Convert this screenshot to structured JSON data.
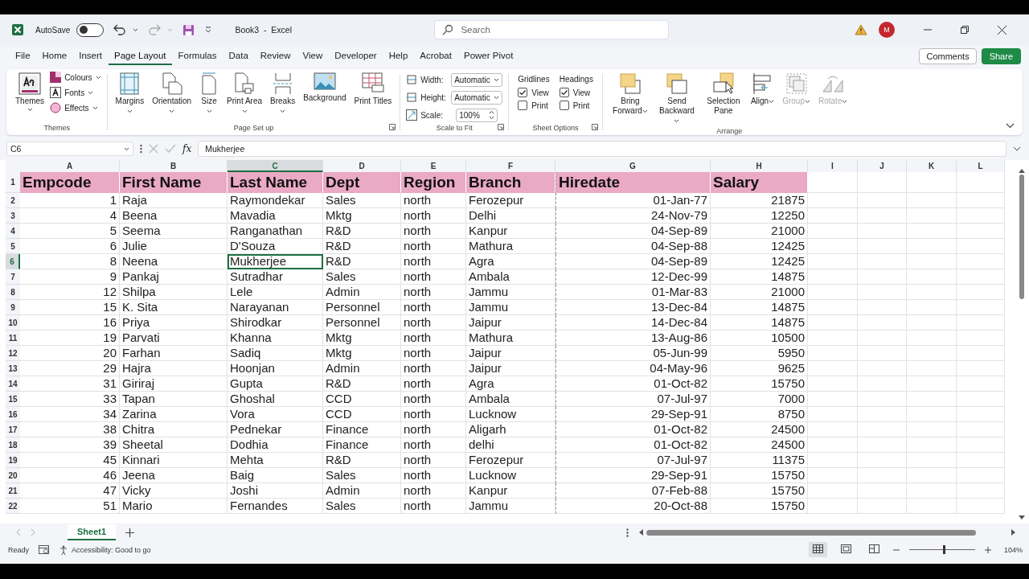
{
  "titlebar": {
    "autosave": {
      "label": "AutoSave",
      "on": false
    },
    "title": "Book3  -  Excel",
    "search": {
      "placeholder": "Search"
    },
    "avatar": "M"
  },
  "tabs": [
    {
      "label": "File",
      "selected": false
    },
    {
      "label": "Home",
      "selected": false
    },
    {
      "label": "Insert",
      "selected": false
    },
    {
      "label": "Page Layout",
      "selected": true
    },
    {
      "label": "Formulas",
      "selected": false
    },
    {
      "label": "Data",
      "selected": false
    },
    {
      "label": "Review",
      "selected": false
    },
    {
      "label": "View",
      "selected": false
    },
    {
      "label": "Developer",
      "selected": false
    },
    {
      "label": "Help",
      "selected": false
    },
    {
      "label": "Acrobat",
      "selected": false
    },
    {
      "label": "Power Pivot",
      "selected": false
    }
  ],
  "comments_button": "Comments",
  "share_button": "Share",
  "themes_group": {
    "label": "Themes",
    "button": "Themes",
    "items": [
      {
        "label": "Colours",
        "kind": "colours"
      },
      {
        "label": "Fonts",
        "kind": "fonts"
      },
      {
        "label": "Effects",
        "kind": "effects"
      }
    ]
  },
  "page_setup_group": {
    "label": "Page Set up",
    "buttons": [
      {
        "label": "Margins",
        "kind": "margins",
        "dropdown": true
      },
      {
        "label": "Orientation",
        "kind": "orientation",
        "dropdown": true
      },
      {
        "label": "Size",
        "kind": "size",
        "dropdown": true
      },
      {
        "label": "Print Area",
        "kind": "printarea",
        "dropdown": true
      },
      {
        "label": "Breaks",
        "kind": "breaks",
        "dropdown": true
      },
      {
        "label": "Background",
        "kind": "background",
        "dropdown": false
      },
      {
        "label": "Print Titles",
        "kind": "printtitles",
        "dropdown": false
      }
    ]
  },
  "scale_group": {
    "label": "Scale to Fit",
    "fields": [
      {
        "label": "Width:",
        "value": "Automatic",
        "kind": "select"
      },
      {
        "label": "Height:",
        "value": "Automatic",
        "kind": "select"
      },
      {
        "label": "Scale:",
        "value": "100%",
        "kind": "spin"
      }
    ]
  },
  "sheet_options_group": {
    "label": "Sheet Options",
    "columns": [
      {
        "title": "Gridlines",
        "options": [
          {
            "label": "View",
            "checked": true
          },
          {
            "label": "Print",
            "checked": false
          }
        ]
      },
      {
        "title": "Headings",
        "options": [
          {
            "label": "View",
            "checked": true
          },
          {
            "label": "Print",
            "checked": false
          }
        ]
      }
    ]
  },
  "arrange_group": {
    "label": "Arrange",
    "buttons": [
      {
        "label": "Bring Forward",
        "kind": "bring",
        "dropdown": true,
        "disabled": false
      },
      {
        "label": "Send Backward",
        "kind": "send",
        "dropdown": true,
        "disabled": false
      },
      {
        "label": "Selection Pane",
        "kind": "pane",
        "dropdown": false,
        "disabled": false
      },
      {
        "label": "Align",
        "kind": "align",
        "dropdown": true,
        "disabled": false
      },
      {
        "label": "Group",
        "kind": "group",
        "dropdown": true,
        "disabled": true
      },
      {
        "label": "Rotate",
        "kind": "rotate",
        "dropdown": true,
        "disabled": true
      }
    ]
  },
  "formula_bar": {
    "name_box": "C6",
    "fx_label": "fx",
    "formula": "Mukherjee"
  },
  "sheet": {
    "columns": [
      {
        "label": "A",
        "selected": false
      },
      {
        "label": "B",
        "selected": false
      },
      {
        "label": "C",
        "selected": true
      },
      {
        "label": "D",
        "selected": false
      },
      {
        "label": "E",
        "selected": false
      },
      {
        "label": "F",
        "selected": false
      },
      {
        "label": "G",
        "selected": false
      },
      {
        "label": "H",
        "selected": false
      },
      {
        "label": "I",
        "selected": false
      },
      {
        "label": "J",
        "selected": false
      },
      {
        "label": "K",
        "selected": false
      },
      {
        "label": "L",
        "selected": false
      }
    ],
    "header_row": {
      "num": "1",
      "cells": [
        "Empcode",
        "First Name",
        "Last Name",
        "Dept",
        "Region",
        "Branch",
        "Hiredate",
        "Salary"
      ]
    },
    "rows": [
      {
        "num": "2",
        "selected": false,
        "cells": [
          "1",
          "Raja",
          "Raymondekar",
          "Sales",
          "north",
          "Ferozepur",
          "01-Jan-77",
          "21875"
        ]
      },
      {
        "num": "3",
        "selected": false,
        "cells": [
          "4",
          "Beena",
          "Mavadia",
          "Mktg",
          "north",
          "Delhi",
          "24-Nov-79",
          "12250"
        ]
      },
      {
        "num": "4",
        "selected": false,
        "cells": [
          "5",
          "Seema",
          "Ranganathan",
          "R&D",
          "north",
          "Kanpur",
          "04-Sep-89",
          "21000"
        ]
      },
      {
        "num": "5",
        "selected": false,
        "cells": [
          "6",
          "Julie",
          "D'Souza",
          "R&D",
          "north",
          "Mathura",
          "04-Sep-88",
          "12425"
        ]
      },
      {
        "num": "6",
        "selected": true,
        "cells": [
          "8",
          "Neena",
          "Mukherjee",
          "R&D",
          "north",
          "Agra",
          "04-Sep-89",
          "12425"
        ]
      },
      {
        "num": "7",
        "selected": false,
        "cells": [
          "9",
          "Pankaj",
          "Sutradhar",
          "Sales",
          "north",
          "Ambala",
          "12-Dec-99",
          "14875"
        ]
      },
      {
        "num": "8",
        "selected": false,
        "cells": [
          "12",
          "Shilpa",
          "Lele",
          "Admin",
          "north",
          "Jammu",
          "01-Mar-83",
          "21000"
        ]
      },
      {
        "num": "9",
        "selected": false,
        "cells": [
          "15",
          "K. Sita",
          "Narayanan",
          "Personnel",
          "north",
          "Jammu",
          "13-Dec-84",
          "14875"
        ]
      },
      {
        "num": "10",
        "selected": false,
        "cells": [
          "16",
          "Priya",
          "Shirodkar",
          "Personnel",
          "north",
          "Jaipur",
          "14-Dec-84",
          "14875"
        ]
      },
      {
        "num": "11",
        "selected": false,
        "cells": [
          "19",
          "Parvati",
          "Khanna",
          "Mktg",
          "north",
          "Mathura",
          "13-Aug-86",
          "10500"
        ]
      },
      {
        "num": "12",
        "selected": false,
        "cells": [
          "20",
          "Farhan",
          "Sadiq",
          "Mktg",
          "north",
          "Jaipur",
          "05-Jun-99",
          "5950"
        ]
      },
      {
        "num": "13",
        "selected": false,
        "cells": [
          "29",
          "Hajra",
          "Hoonjan",
          "Admin",
          "north",
          "Jaipur",
          "04-May-96",
          "9625"
        ]
      },
      {
        "num": "14",
        "selected": false,
        "cells": [
          "31",
          "Giriraj",
          "Gupta",
          "R&D",
          "north",
          "Agra",
          "01-Oct-82",
          "15750"
        ]
      },
      {
        "num": "15",
        "selected": false,
        "cells": [
          "33",
          "Tapan",
          "Ghoshal",
          "CCD",
          "north",
          "Ambala",
          "07-Jul-97",
          "7000"
        ]
      },
      {
        "num": "16",
        "selected": false,
        "cells": [
          "34",
          "Zarina",
          "Vora",
          "CCD",
          "north",
          "Lucknow",
          "29-Sep-91",
          "8750"
        ]
      },
      {
        "num": "17",
        "selected": false,
        "cells": [
          "38",
          "Chitra",
          "Pednekar",
          "Finance",
          "north",
          "Aligarh",
          "01-Oct-82",
          "24500"
        ]
      },
      {
        "num": "18",
        "selected": false,
        "cells": [
          "39",
          "Sheetal",
          "Dodhia",
          "Finance",
          "north",
          "delhi",
          "01-Oct-82",
          "24500"
        ]
      },
      {
        "num": "19",
        "selected": false,
        "cells": [
          "45",
          "Kinnari",
          "Mehta",
          "R&D",
          "north",
          "Ferozepur",
          "07-Jul-97",
          "11375"
        ]
      },
      {
        "num": "20",
        "selected": false,
        "cells": [
          "46",
          "Jeena",
          "Baig",
          "Sales",
          "north",
          "Lucknow",
          "29-Sep-91",
          "15750"
        ]
      },
      {
        "num": "21",
        "selected": false,
        "cells": [
          "47",
          "Vicky",
          "Joshi",
          "Admin",
          "north",
          "Kanpur",
          "07-Feb-88",
          "15750"
        ]
      },
      {
        "num": "22",
        "selected": false,
        "cells": [
          "51",
          "Mario",
          "Fernandes",
          "Sales",
          "north",
          "Jammu",
          "20-Oct-88",
          "15750"
        ]
      }
    ]
  },
  "sheet_tabs": [
    {
      "label": "Sheet1",
      "selected": true
    }
  ],
  "status_bar": {
    "ready": "Ready",
    "accessibility": "Accessibility: Good to go",
    "zoom": "104%",
    "zoom_slider": {
      "level": 0.52
    }
  }
}
